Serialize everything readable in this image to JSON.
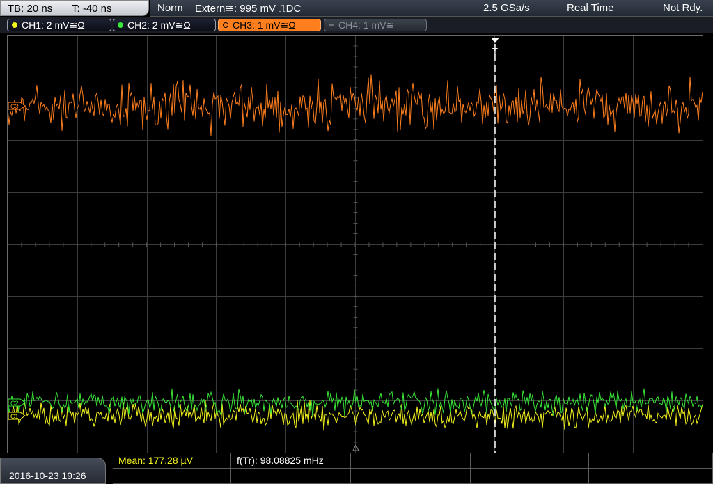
{
  "topbar": {
    "timebase": "TB: 20 ns",
    "trigger_time": "T: -40 ns",
    "trigger_mode": "Norm",
    "trigger_source": "Extern≅: 995 mV ⎍DC",
    "sample_rate": "2.5 GSa/s",
    "acq_mode": "Real Time",
    "status": "Not Rdy."
  },
  "channels": [
    {
      "label": "CH1: 2 mV≅Ω",
      "color": "#f5f51e",
      "state": "inactive"
    },
    {
      "label": "CH2: 2 mV≅Ω",
      "color": "#39e639",
      "state": "inactive"
    },
    {
      "label": "CH3: 1 mV≅Ω",
      "color": "#ff7f1e",
      "state": "active"
    },
    {
      "label": "CH4: 1 mV≅",
      "color": "#8c929c",
      "state": "off"
    }
  ],
  "trace_markers": {
    "ch3": "C3",
    "ch2": "C2",
    "ch1": "C1",
    "trigger": "T"
  },
  "colors": {
    "ch1": "#f5f51e",
    "ch2": "#39e639",
    "ch3": "#ff7f1e",
    "grid": "#3c3c3c"
  },
  "bottom": {
    "datetime": "2016-10-23 19:26",
    "mean_label": "Mean: 177.28 µV",
    "freq_label": "f(Tr): 98.08825 mHz"
  }
}
